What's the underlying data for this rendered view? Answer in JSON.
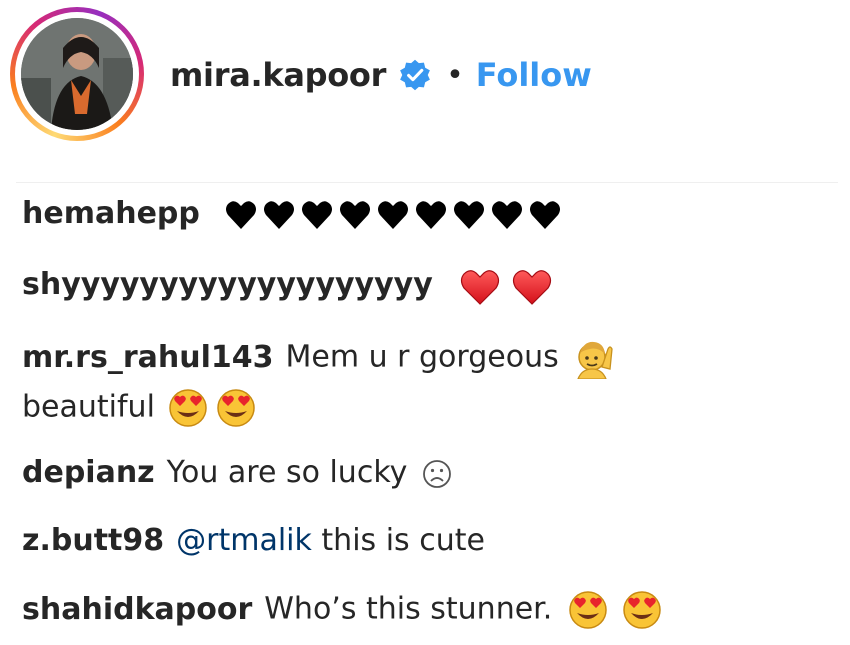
{
  "post_header": {
    "username": "mira.kapoor",
    "separator": "•",
    "follow_label": "Follow",
    "verified_badge_icon": "verified-badge-icon",
    "accent_color": "#3897f0"
  },
  "comments": [
    {
      "user": "hemahepp",
      "text": "",
      "emojis": [
        "black-heart",
        "black-heart",
        "black-heart",
        "black-heart",
        "black-heart",
        "black-heart",
        "black-heart",
        "black-heart",
        "black-heart"
      ]
    },
    {
      "user": "shyyyyyyyyyyyyyyyyyyy",
      "text": "",
      "emojis": [
        "red-heart",
        "red-heart"
      ]
    },
    {
      "user": "mr.rs_rahul143",
      "text": "Mem u r gorgeous",
      "emojis": [
        "person-raising-hand"
      ],
      "continuation": "beautiful",
      "continuation_emojis": [
        "heart-eyes",
        "heart-eyes"
      ]
    },
    {
      "user": "depianz",
      "text": "You are so lucky",
      "emojis": [
        "frowning-face"
      ]
    },
    {
      "user": "z.butt98",
      "mention": "@rtmalik",
      "text": "this is cute",
      "emojis": []
    },
    {
      "user": "shahidkapoor",
      "text": "Who’s this stunner.",
      "emojis": [
        "heart-eyes",
        "heart-eyes"
      ]
    }
  ]
}
